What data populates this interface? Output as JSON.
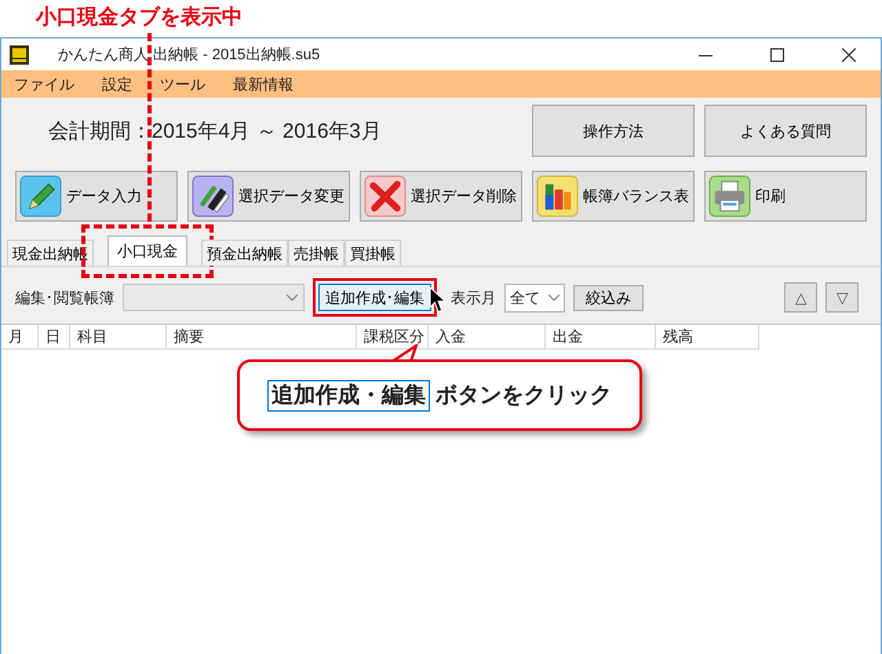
{
  "annotation": {
    "title": "小口現金タブを表示中"
  },
  "window": {
    "title": "かんたん商人 出納帳 - 2015出納帳.su5"
  },
  "menu": [
    "ファイル",
    "設定",
    "ツール",
    "最新情報"
  ],
  "period": "会計期間：2015年4月 ～ 2016年3月",
  "help_buttons": [
    "操作方法",
    "よくある質問"
  ],
  "toolbar": [
    {
      "label": "データ入力",
      "kind": "pencil"
    },
    {
      "label": "選択データ変更",
      "kind": "pens"
    },
    {
      "label": "選択データ削除",
      "kind": "cross"
    },
    {
      "label": "帳簿バランス表",
      "kind": "chart"
    },
    {
      "label": "印刷",
      "kind": "printer"
    }
  ],
  "tabs": [
    {
      "label": "現金出納帳",
      "selected": false
    },
    {
      "label": "小口現金",
      "selected": true
    },
    {
      "label": "預金出納帳",
      "selected": false
    },
    {
      "label": "売掛帳",
      "selected": false
    },
    {
      "label": "買掛帳",
      "selected": false
    }
  ],
  "filter": {
    "ledger_label": "編集･閲覧帳簿",
    "add_button": "追加作成･編集",
    "month_label": "表示月",
    "month_value": "全て",
    "filter_button": "絞込み",
    "up": "△",
    "down": "▽"
  },
  "table": {
    "columns": [
      "月",
      "日",
      "科目",
      "摘要",
      "課税区分",
      "入金",
      "出金",
      "残高"
    ]
  },
  "callout": {
    "highlight": "追加作成・編集",
    "text": "ボタンをクリック"
  }
}
